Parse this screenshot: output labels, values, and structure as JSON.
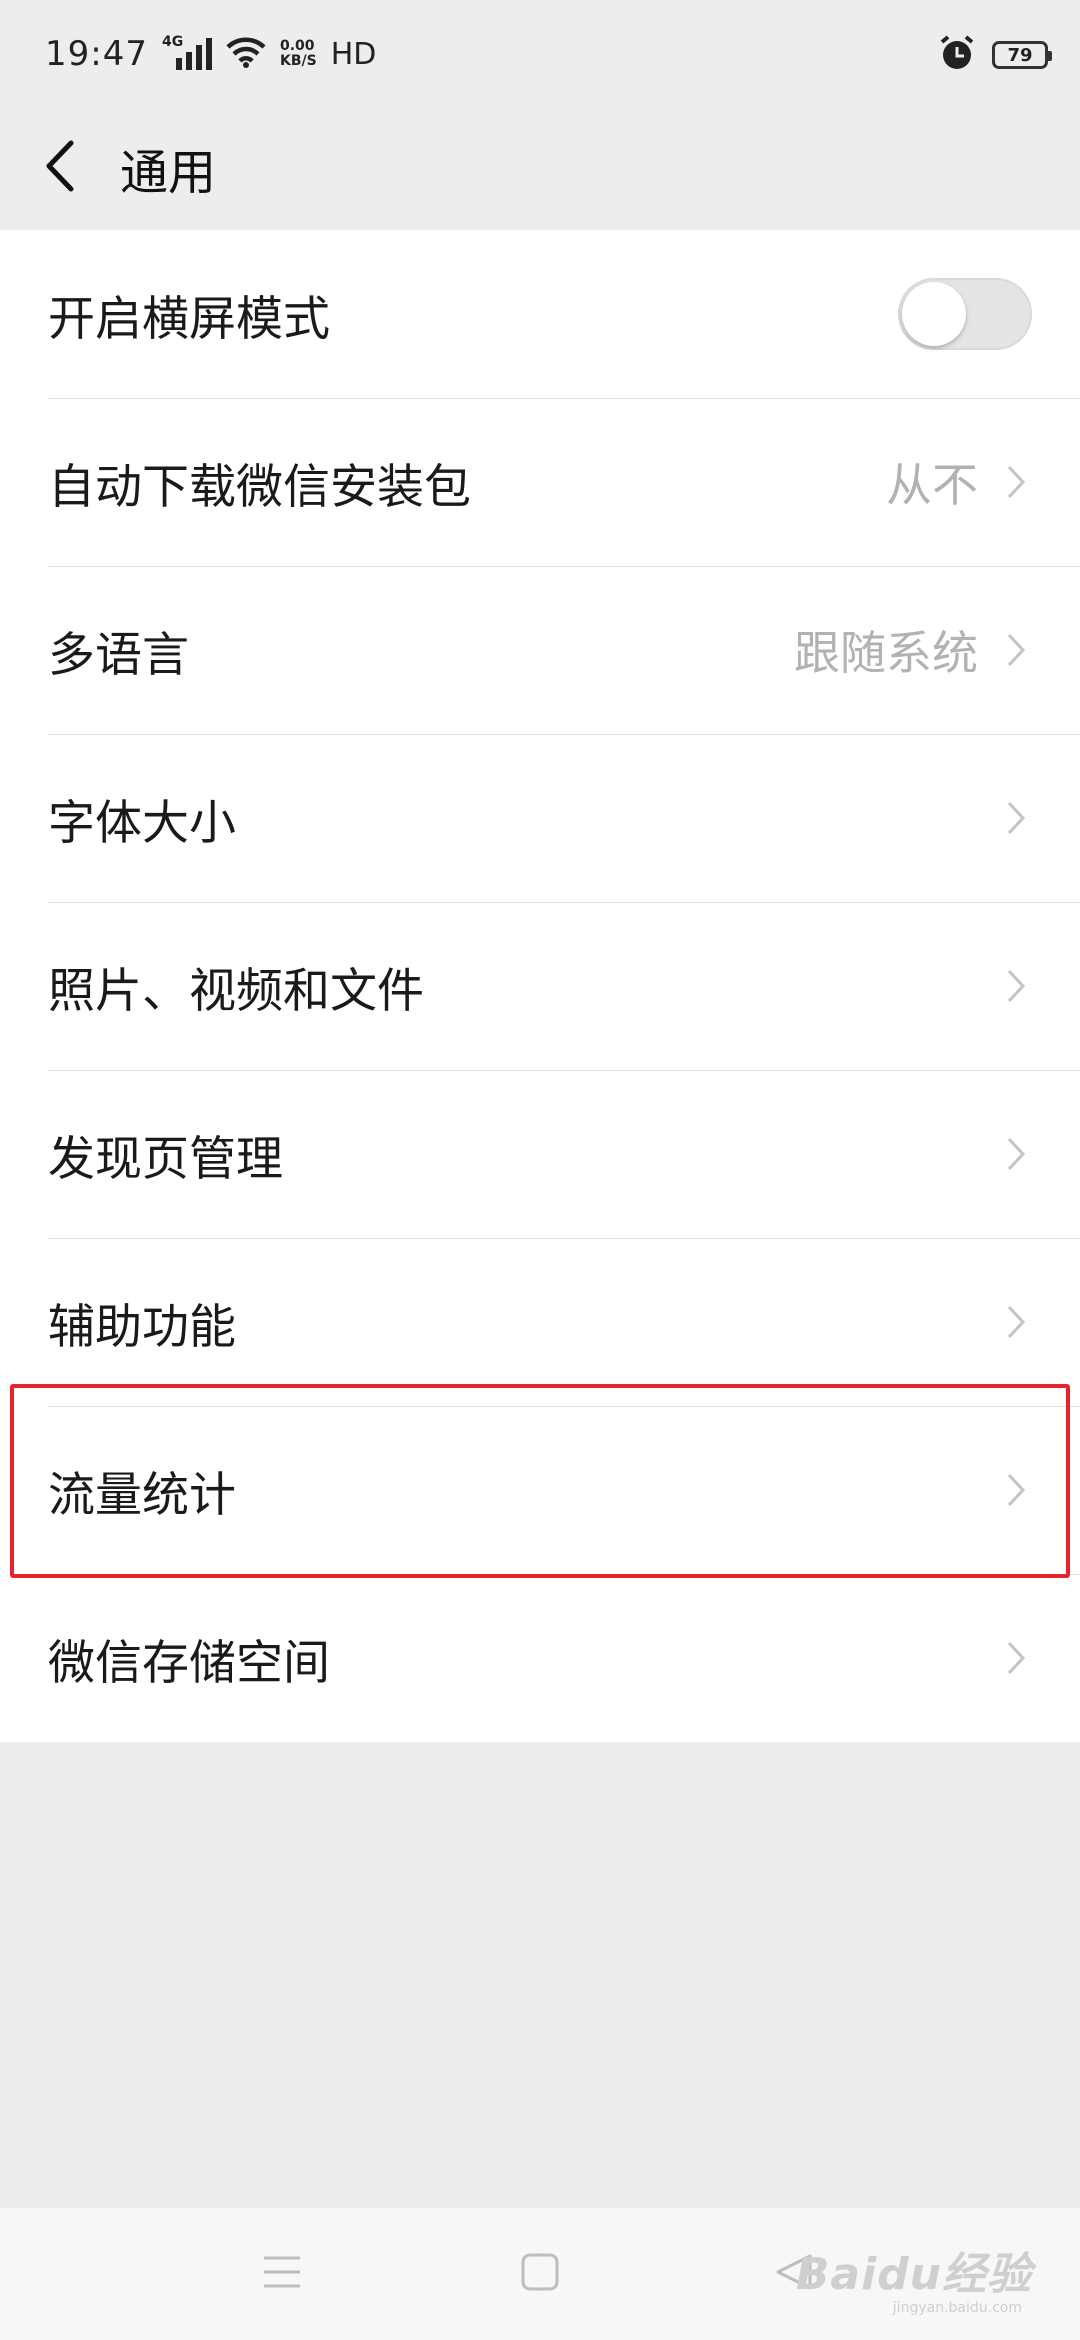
{
  "status_bar": {
    "time": "19:47",
    "network": "4G",
    "speed_value": "0.00",
    "speed_unit": "KB/S",
    "hd": "HD",
    "battery": "79"
  },
  "header": {
    "title": "通用"
  },
  "settings": {
    "landscape_mode": {
      "label": "开启横屏模式",
      "enabled": false
    },
    "items": [
      {
        "label": "自动下载微信安装包",
        "value": "从不"
      },
      {
        "label": "多语言",
        "value": "跟随系统"
      },
      {
        "label": "字体大小",
        "value": ""
      },
      {
        "label": "照片、视频和文件",
        "value": ""
      },
      {
        "label": "发现页管理",
        "value": ""
      },
      {
        "label": "辅助功能",
        "value": ""
      },
      {
        "label": "流量统计",
        "value": ""
      },
      {
        "label": "微信存储空间",
        "value": ""
      }
    ],
    "highlighted_item": "流量统计",
    "highlight_color": "#e8232b"
  },
  "nav_bar": {
    "icons": [
      "menu-icon",
      "home-icon",
      "back-triangle-icon"
    ]
  },
  "watermark": {
    "text": "Baidu经验",
    "sub": "jingyan.baidu.com"
  },
  "colors": {
    "background": "#ededed",
    "list_bg": "#ffffff",
    "secondary_text": "#b2b2b2"
  }
}
